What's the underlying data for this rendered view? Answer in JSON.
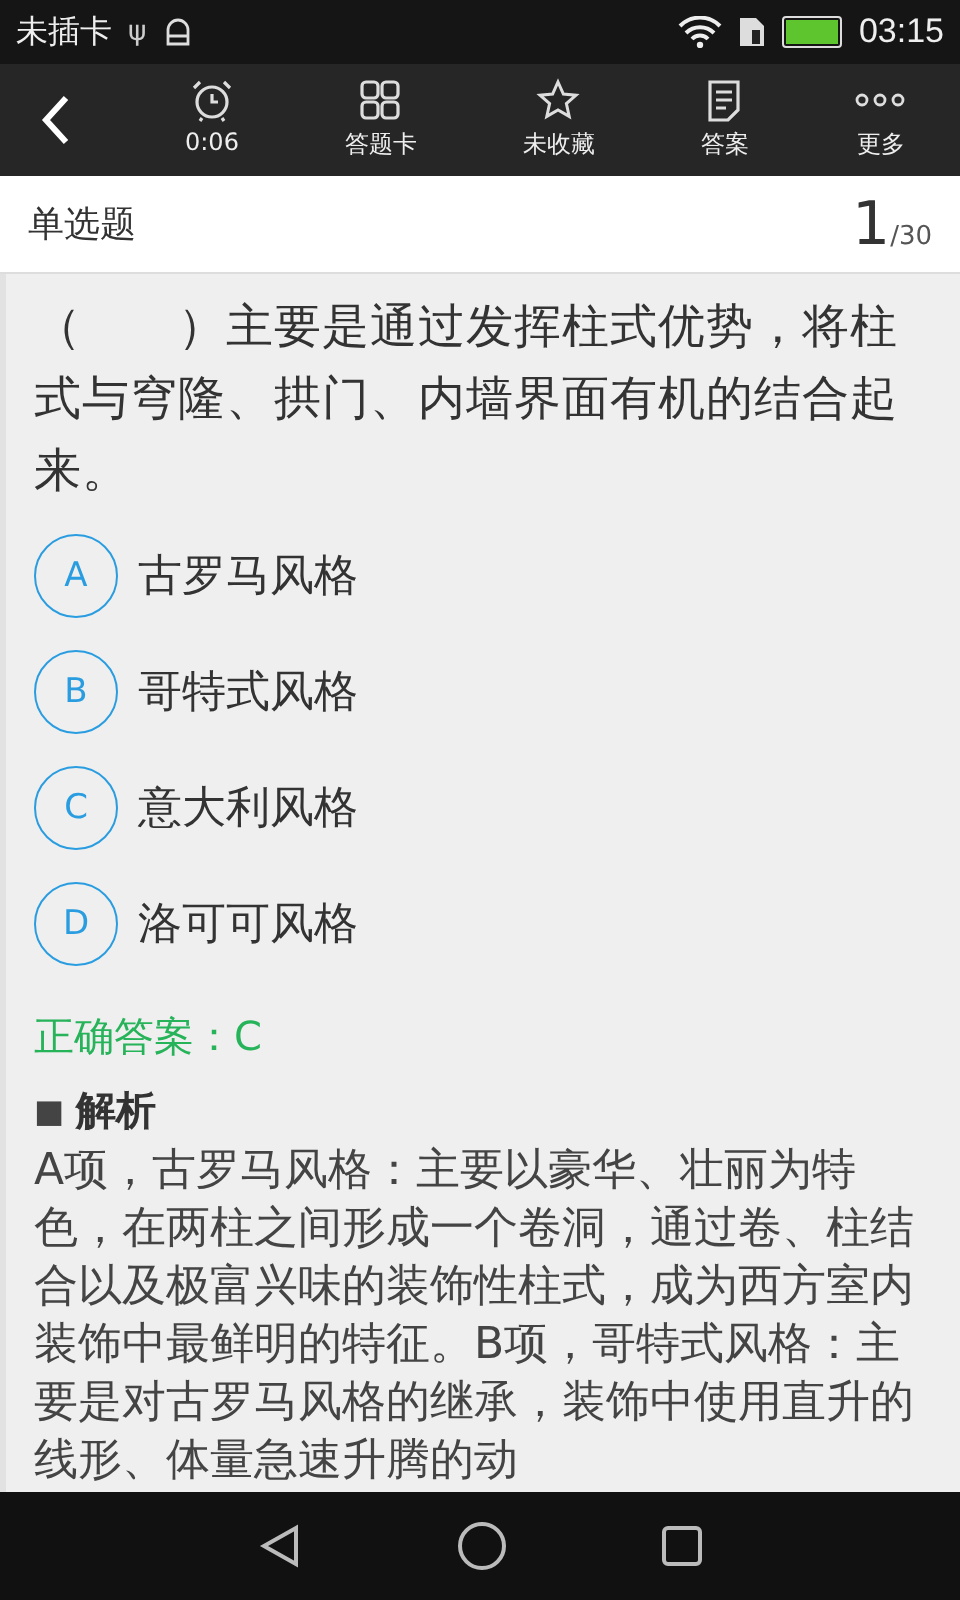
{
  "status_bar": {
    "carrier": "未插卡",
    "usb_glyph": "ψ",
    "time": "03:15"
  },
  "toolbar": {
    "items": [
      {
        "kind": "alarm",
        "label": "0:06"
      },
      {
        "kind": "grid",
        "label": "答题卡"
      },
      {
        "kind": "star",
        "label": "未收藏"
      },
      {
        "kind": "doc",
        "label": "答案"
      },
      {
        "kind": "dots",
        "label": "更多"
      }
    ]
  },
  "header": {
    "type": "单选题",
    "current": "1",
    "total": "/30"
  },
  "question": "（　　）主要是通过发挥柱式优势，将柱式与穹隆、拱门、内墙界面有机的结合起来。",
  "options": [
    {
      "letter": "A",
      "text": "古罗马风格",
      "selected": false
    },
    {
      "letter": "B",
      "text": "哥特式风格",
      "selected": false
    },
    {
      "letter": "C",
      "text": "意大利风格",
      "selected": false
    },
    {
      "letter": "D",
      "text": "洛可可风格",
      "selected": false
    }
  ],
  "answer": "正确答案：C",
  "analysis": {
    "marker": "■",
    "title": "解析",
    "text": "A项，古罗马风格：主要以豪华、壮丽为特色，在两柱之间形成一个卷洞，通过卷、柱结合以及极富兴味的装饰性柱式，成为西方室内装饰中最鲜明的特征。B项，哥特式风格：主要是对古罗马风格的继承，装饰中使用直升的线形、体量急速升腾的动"
  }
}
